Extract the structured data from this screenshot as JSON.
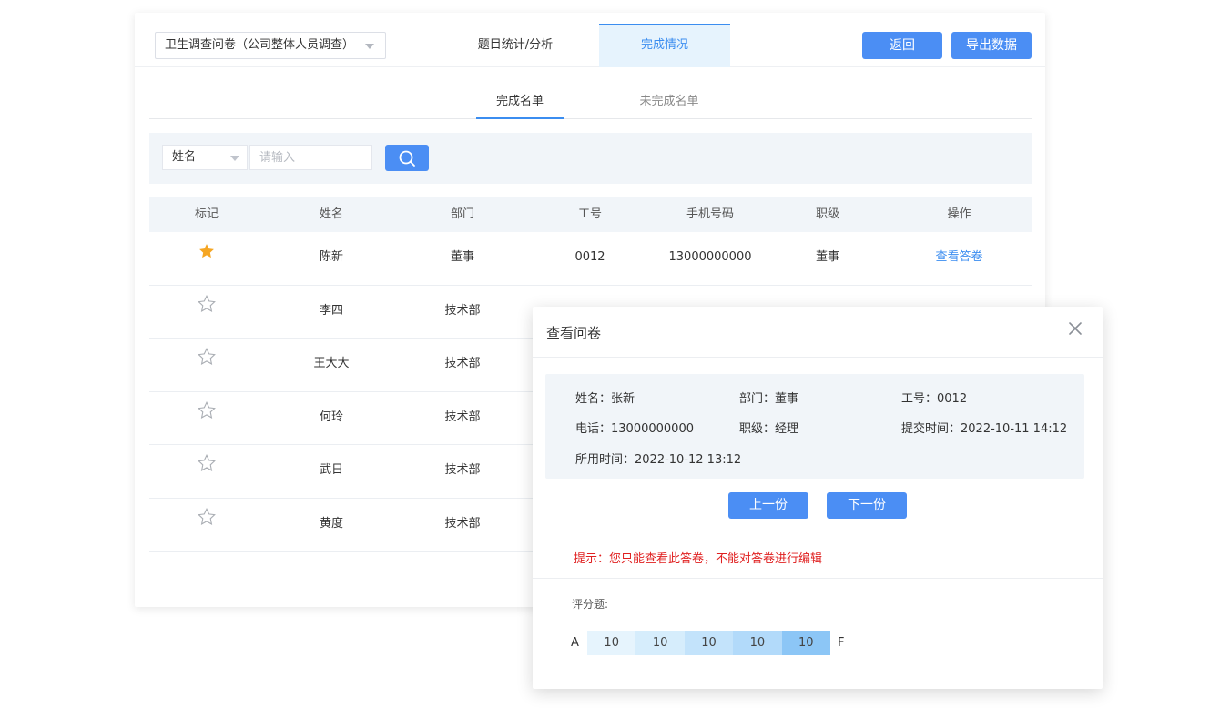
{
  "survey_select": {
    "value": "卫生调查问卷（公司整体人员调查）"
  },
  "tabs": [
    {
      "label": "题目统计/分析"
    },
    {
      "label": "完成情况"
    }
  ],
  "actions": {
    "back": "返回",
    "export": "导出数据"
  },
  "subtabs": [
    {
      "label": "完成名单"
    },
    {
      "label": "未完成名单"
    }
  ],
  "filter": {
    "field": "姓名",
    "placeholder": "请输入"
  },
  "table": {
    "headers": [
      "标记",
      "姓名",
      "部门",
      "工号",
      "手机号码",
      "职级",
      "操作"
    ],
    "rows": [
      {
        "marked": true,
        "name": "陈新",
        "dept": "董事",
        "id": "0012",
        "phone": "13000000000",
        "level": "董事",
        "action": "查看答卷"
      },
      {
        "marked": false,
        "name": "李四",
        "dept": "技术部"
      },
      {
        "marked": false,
        "name": "王大大",
        "dept": "技术部"
      },
      {
        "marked": false,
        "name": "何玲",
        "dept": "技术部"
      },
      {
        "marked": false,
        "name": "武日",
        "dept": "技术部"
      },
      {
        "marked": false,
        "name": "黄度",
        "dept": "技术部"
      }
    ]
  },
  "modal": {
    "title": "查看问卷",
    "info": {
      "name": "姓名：张新",
      "dept": "部门：董事",
      "id": "工号：0012",
      "phone": "电话：13000000000",
      "level": "职级：经理",
      "submit_time": "提交时间：2022-10-11 14:12",
      "used_time": "所用时间：2022-10-12 13:12"
    },
    "prev": "上一份",
    "next": "下一份",
    "tip": "提示：您只能查看此答卷，不能对答卷进行编辑",
    "score_label": "评分题:",
    "scale": {
      "start": "A",
      "end": "F",
      "cells": [
        "10",
        "10",
        "10",
        "10",
        "10"
      ],
      "colors": [
        "#e6f4fd",
        "#d6edfc",
        "#c3e3fb",
        "#b2dafa",
        "#8cc6f6"
      ]
    }
  },
  "colors": {
    "primary": "#4b8ef4",
    "tab_active_bg": "#e6f3fd",
    "star": "#f5a623",
    "tip": "#e02020"
  }
}
